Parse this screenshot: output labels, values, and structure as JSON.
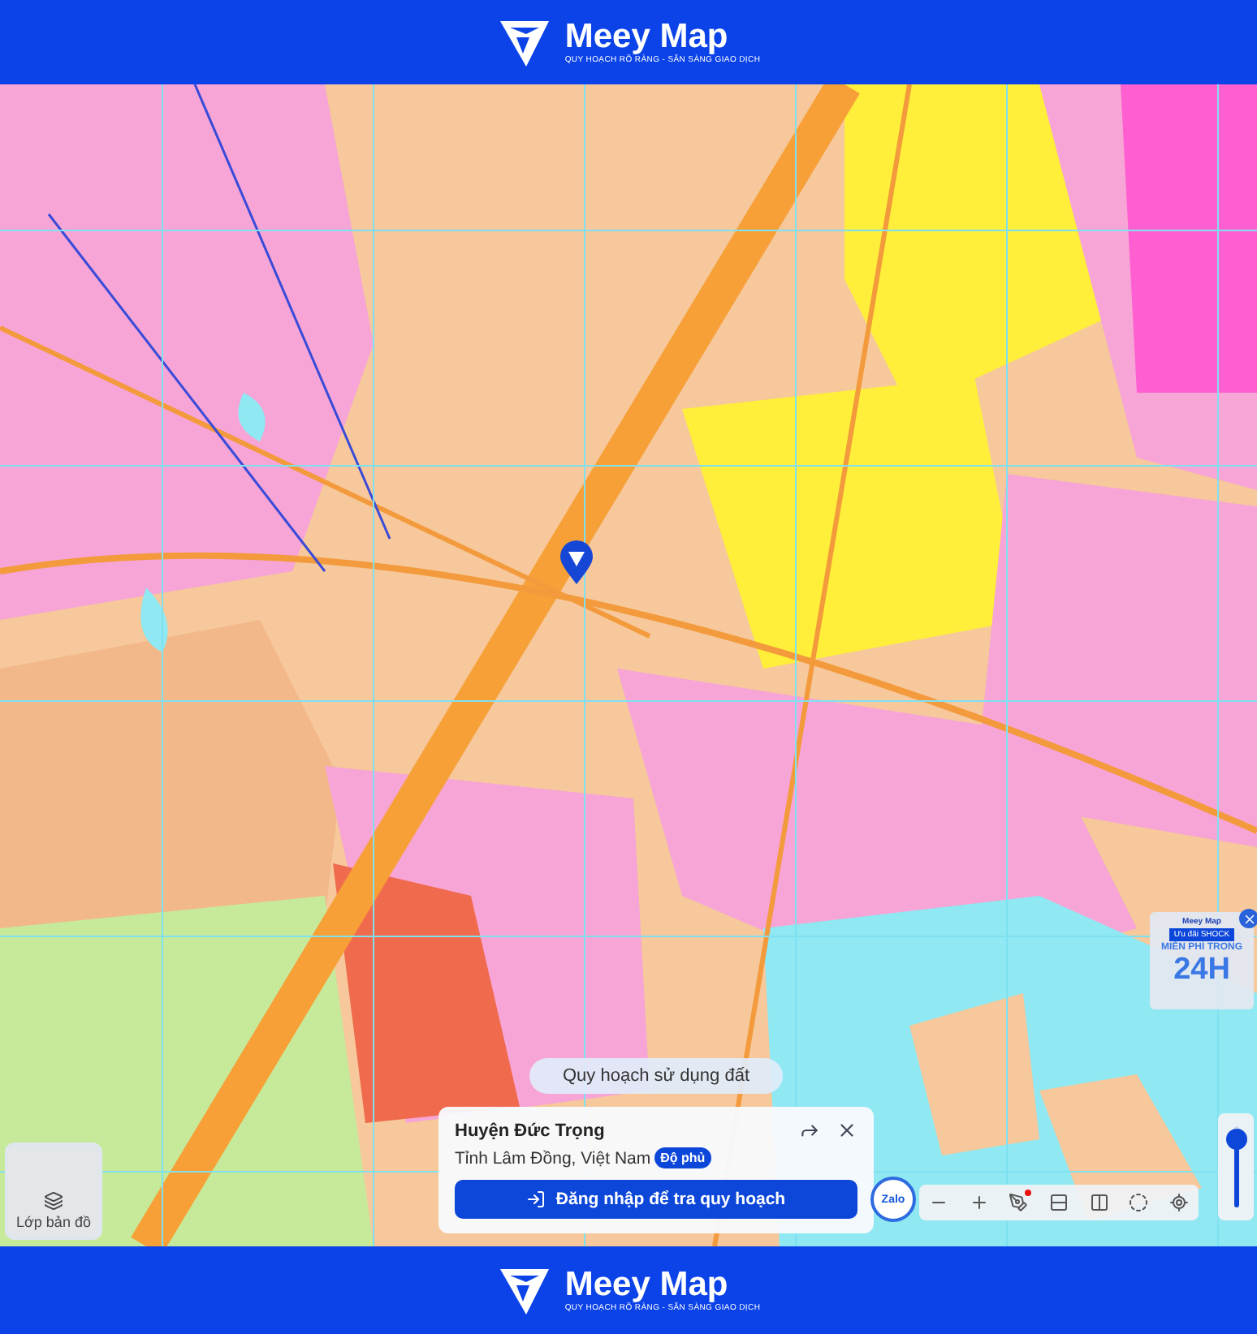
{
  "header": {
    "brand": "Meey Map",
    "tagline": "QUY HOẠCH RÕ RÀNG - SẴN SÀNG GIAO DỊCH"
  },
  "map": {
    "layer_chip": "Quy hoạch sử dụng đất",
    "info_card": {
      "title": "Huyện Đức Trọng",
      "subtitle": "Tỉnh Lâm Đồng, Việt Nam",
      "badge": "Độ phủ",
      "button": "Đăng nhập để tra quy hoạch"
    },
    "layer_button": "Lớp bản đồ",
    "zalo": "Zalo",
    "opacity_slider": {
      "level": 0.85
    },
    "ad": {
      "brand": "Meey Map",
      "tag": "Ưu đãi SHOCK",
      "line": "MIỄN PHÍ TRONG",
      "big": "24H"
    }
  },
  "footer": {
    "brand": "Meey Map",
    "tagline": "QUY HOẠCH RÕ RÀNG - SẴN SÀNG GIAO DỊCH"
  }
}
